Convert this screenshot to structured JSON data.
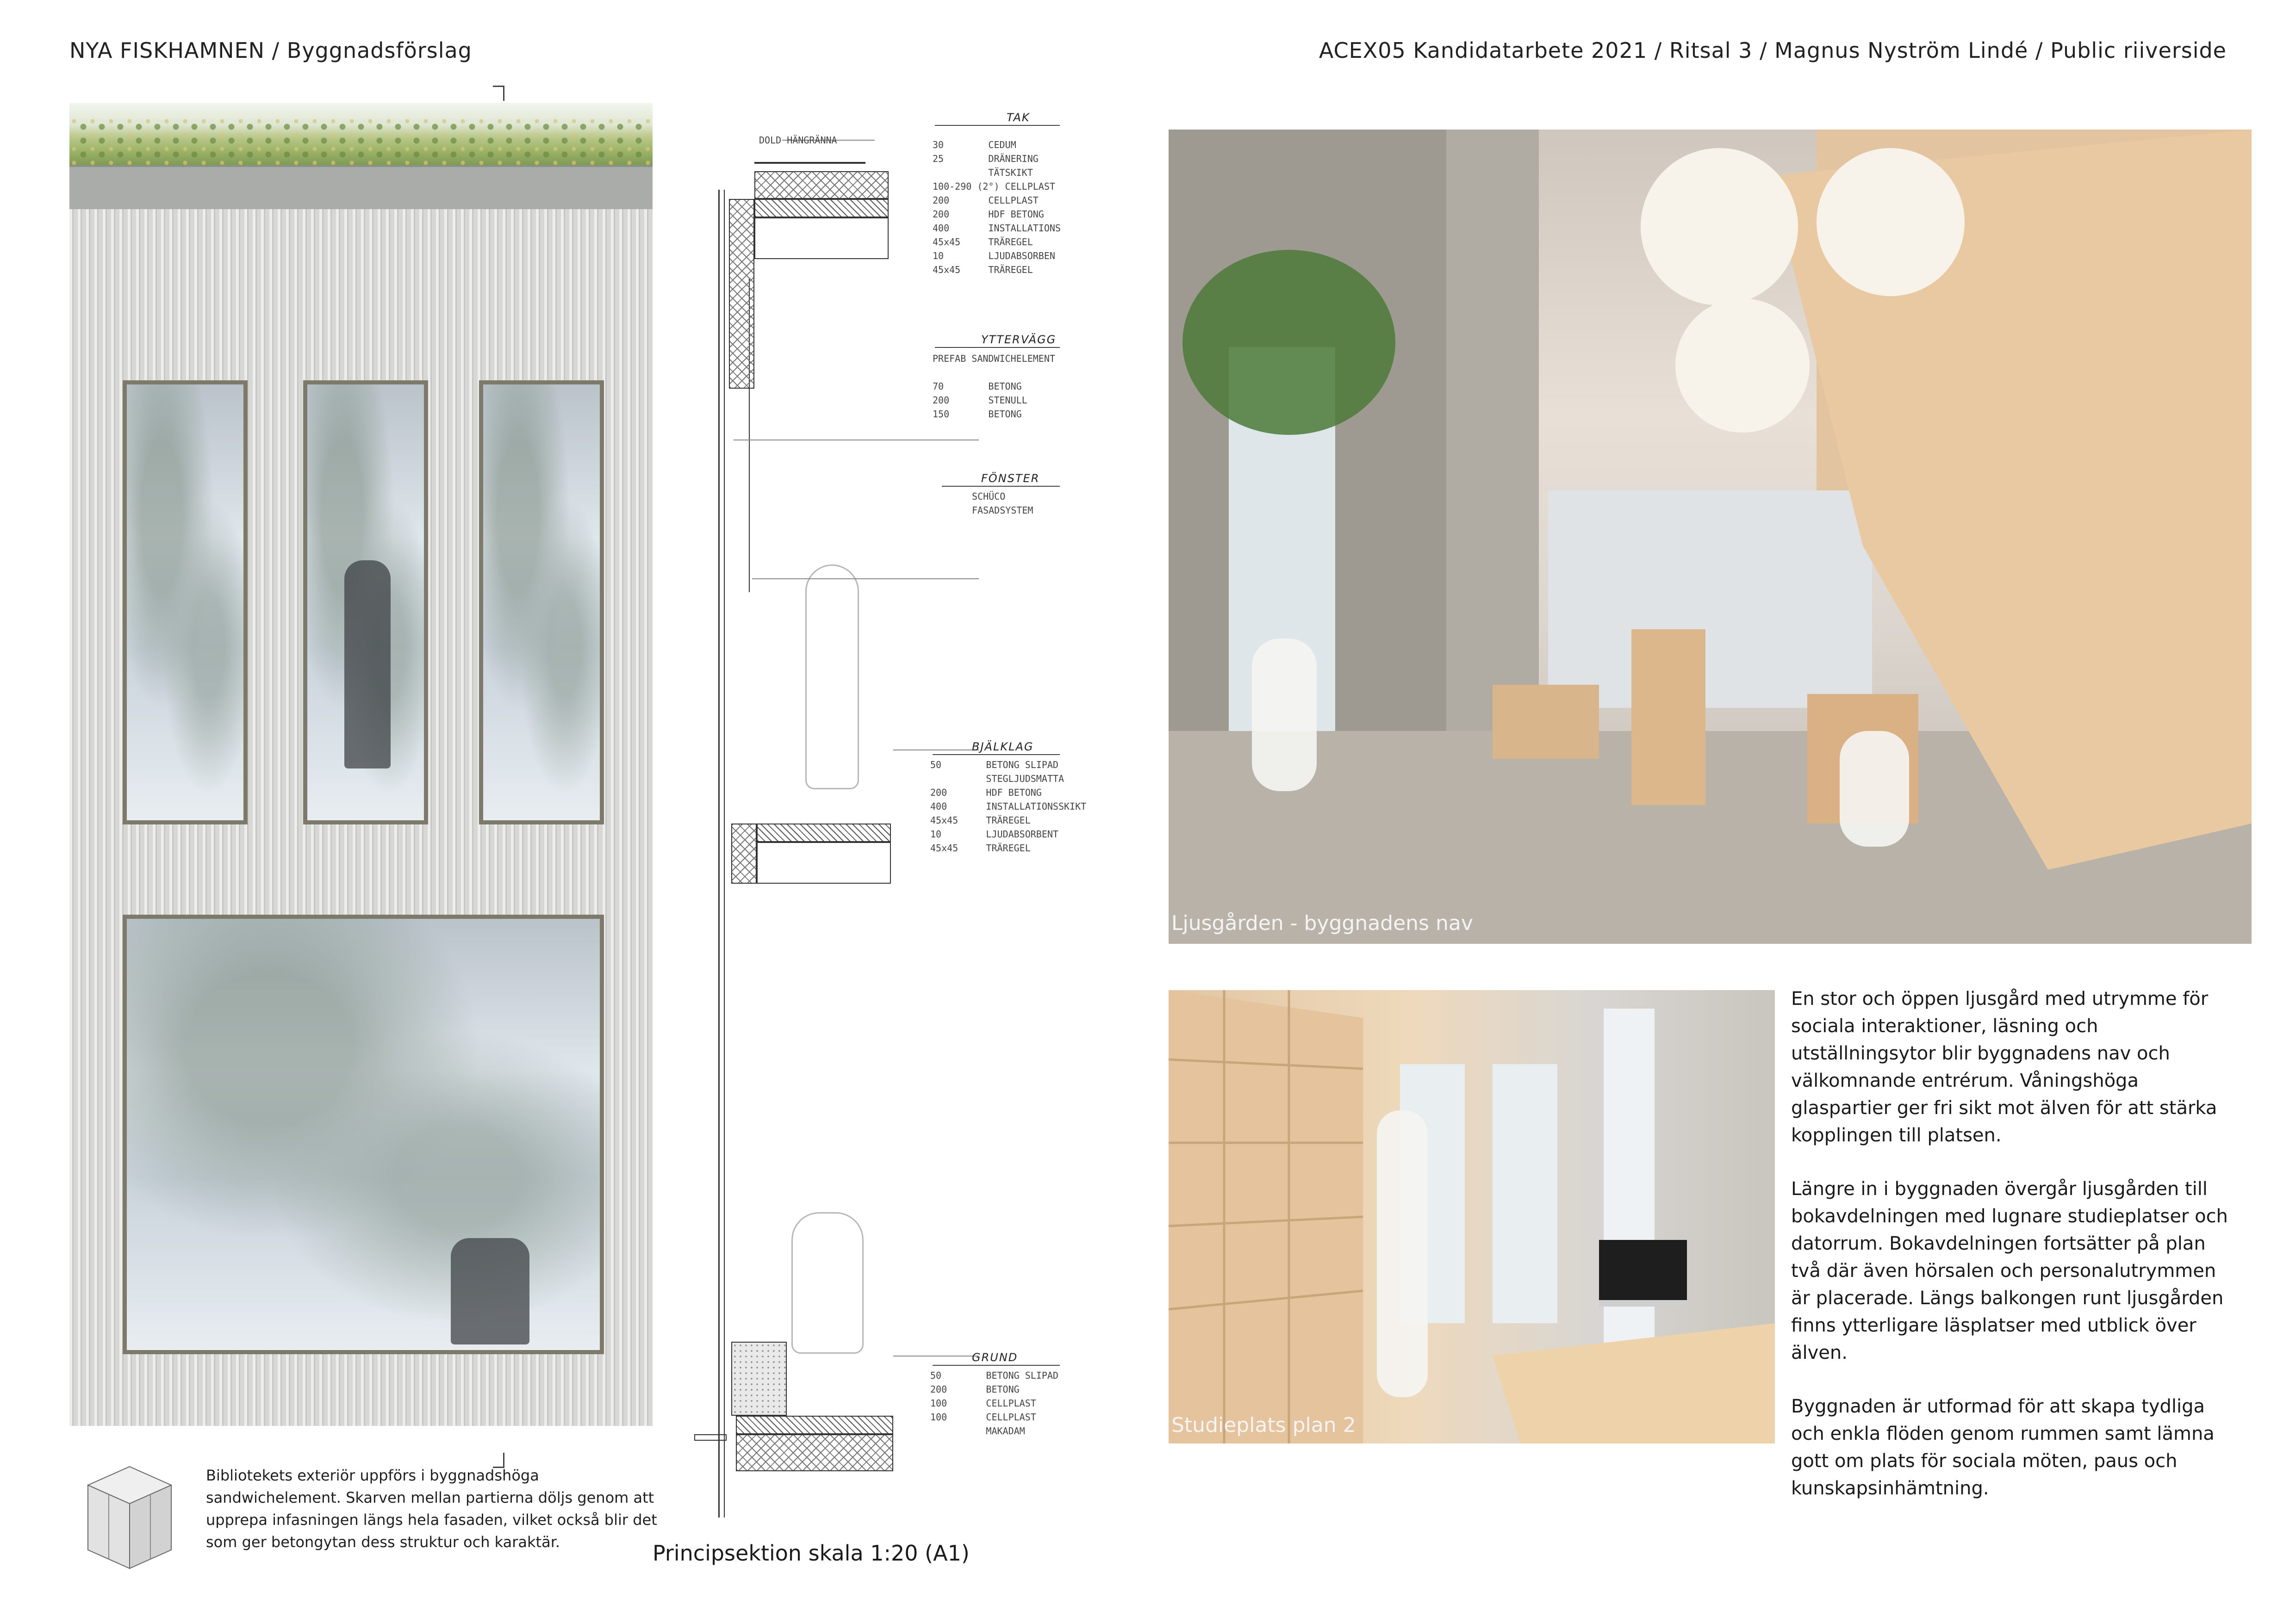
{
  "header": {
    "left": "NYA FISKHAMNEN / Byggnadsförslag",
    "right": "ACEX05 Kandidatarbete 2021 / Ritsal 3 / Magnus Nyström Lindé / Public riiverside"
  },
  "facade": {
    "caption": "Bibliotekets exteriör uppförs i byggnadshöga sandwichelement. Skarven mellan partierna döljs genom att upprepa infasningen längs hela fasaden, vilket också blir det som ger betongytan dess struktur och karaktär."
  },
  "section": {
    "scale_caption": "Principsektion skala 1:20 (A1)",
    "dold_hangranna": "DOLD HÄNGRÄNNA",
    "tak": {
      "title": "TAK",
      "lines": "30        CEDUM\n25        DRÄNERING\n          TÄTSKIKT\n100-290 (2°) CELLPLAST\n200       CELLPLAST\n200       HDF BETONG\n400       INSTALLATIONS\n45x45     TRÄREGEL\n10        LJUDABSORBEN\n45x45     TRÄREGEL"
    },
    "yttervagg": {
      "title": "YTTERVÄGG",
      "lines": "PREFAB SANDWICHELEMENT\n\n70        BETONG\n200       STENULL\n150       BETONG"
    },
    "fonster": {
      "title": "FÖNSTER",
      "lines": "SCHÜCO\nFASADSYSTEM"
    },
    "bjalklag": {
      "title": "BJÄLKLAG",
      "lines": "50        BETONG SLIPAD\n          STEGLJUDSMATTA\n200       HDF BETONG\n400       INSTALLATIONSSKIKT\n45x45     TRÄREGEL\n10        LJUDABSORBENT\n45x45     TRÄREGEL"
    },
    "grund": {
      "title": "GRUND",
      "lines": "50        BETONG SLIPAD\n200       BETONG\n100       CELLPLAST\n100       CELLPLAST\n          MAKADAM"
    }
  },
  "renders": {
    "main_caption": "Ljusgården - byggnadens nav",
    "secondary_caption": "Studieplats plan 2"
  },
  "description": {
    "p1": "En stor och öppen ljusgård med utrymme för sociala interaktioner, läsning och utställningsytor blir byggnadens nav och välkomnande entrérum. Våningshöga glaspartier ger fri sikt mot älven för att stärka kopplingen till platsen.",
    "p2": "Längre in i byggnaden övergår ljusgården till bokavdelningen med lugnare studieplatser och datorrum. Bokavdelningen fortsätter på plan två där även hörsalen och personalutrymmen är placerade. Längs balkongen runt ljusgården finns ytterligare läsplatser med utblick över älven.",
    "p3": "Byggnaden är utformad för att skapa tydliga och enkla flöden genom rummen samt lämna gott om plats för sociala möten,  paus och kunskapsinhämtning."
  }
}
